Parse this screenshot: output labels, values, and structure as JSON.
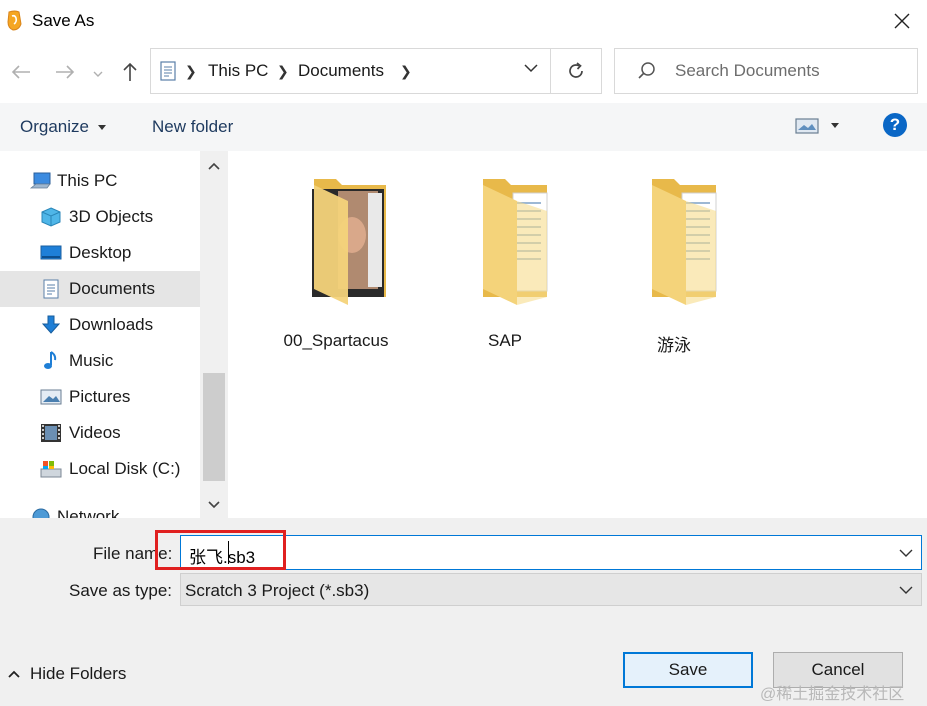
{
  "window": {
    "title": "Save As",
    "app_icon": "scratch-app-icon"
  },
  "nav": {
    "back_icon": "arrow-left-icon",
    "forward_icon": "arrow-right-icon",
    "up_icon": "arrow-up-icon"
  },
  "address": {
    "crumbs": [
      "This PC",
      "Documents"
    ]
  },
  "search": {
    "placeholder": "Search Documents"
  },
  "toolbar": {
    "organize": "Organize",
    "new_folder": "New folder",
    "help": "?"
  },
  "sidebar": {
    "items": [
      {
        "label": "This PC",
        "icon": "computer-icon",
        "selected": false
      },
      {
        "label": "3D Objects",
        "icon": "cube-icon",
        "selected": false
      },
      {
        "label": "Desktop",
        "icon": "desktop-icon",
        "selected": false
      },
      {
        "label": "Documents",
        "icon": "document-icon",
        "selected": true
      },
      {
        "label": "Downloads",
        "icon": "download-icon",
        "selected": false
      },
      {
        "label": "Music",
        "icon": "music-note-icon",
        "selected": false
      },
      {
        "label": "Pictures",
        "icon": "pictures-icon",
        "selected": false
      },
      {
        "label": "Videos",
        "icon": "film-icon",
        "selected": false
      },
      {
        "label": "Local Disk (C:)",
        "icon": "disk-icon",
        "selected": false
      },
      {
        "label": "Network",
        "icon": "network-icon",
        "selected": false
      }
    ]
  },
  "files": [
    {
      "name": "00_Spartacus",
      "icon": "folder-with-photo-icon"
    },
    {
      "name": "SAP",
      "icon": "folder-icon"
    },
    {
      "name": "游泳",
      "icon": "folder-icon"
    }
  ],
  "form": {
    "file_name_label": "File name:",
    "file_name_value": "张飞.sb3",
    "save_type_label": "Save as type:",
    "save_type_value": "Scratch 3 Project (*.sb3)"
  },
  "footer": {
    "hide_folders": "Hide Folders",
    "save": "Save",
    "cancel": "Cancel",
    "watermark": "@稀土掘金技术社区"
  },
  "colors": {
    "accent": "#0078d7",
    "highlight": "#e02020",
    "folder": "#f4d37a"
  }
}
